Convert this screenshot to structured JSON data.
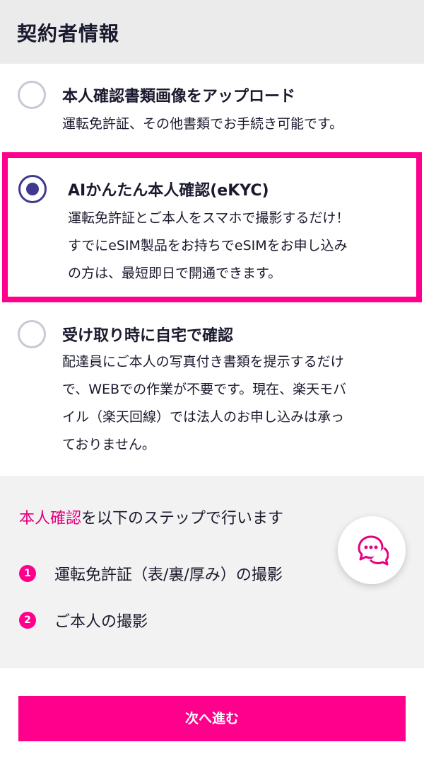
{
  "header": {
    "title": "契約者情報"
  },
  "options": [
    {
      "title": "本人確認書類画像をアップロード",
      "desc_lines": [
        "運転免許証、その他書類でお手続き可能です。"
      ],
      "selected": false
    },
    {
      "title": "AIかんたん本人確認(eKYC)",
      "desc_lines": [
        "運転免許証とご本人をスマホで撮影するだけ！",
        "すでにeSIM製品をお持ちでeSIMをお申し込み",
        "の方は、最短即日で開通できます。"
      ],
      "selected": true
    },
    {
      "title": "受け取り時に自宅で確認",
      "desc_lines": [
        "配達員にご本人の写真付き書類を提示するだけ",
        "で、WEBでの作業が不要です。現在、楽天モバ",
        "イル（楽天回線）では法人のお申し込みは承っ",
        "ておりません。"
      ],
      "selected": false
    }
  ],
  "steps": {
    "heading_highlight": "本人確認",
    "heading_rest": "を以下のステップで行います",
    "items": [
      {
        "num": "1",
        "text": "運転免許証（表/裏/厚み）の撮影"
      },
      {
        "num": "2",
        "text": "ご本人の撮影"
      }
    ]
  },
  "chat": {
    "icon": "chat-bubbles-icon"
  },
  "footer": {
    "next_label": "次へ進む"
  },
  "colors": {
    "accent": "#ff008c",
    "radio_selected": "#3f3a8f",
    "header_bg": "#ebebeb",
    "steps_bg": "#f2f2f2"
  }
}
